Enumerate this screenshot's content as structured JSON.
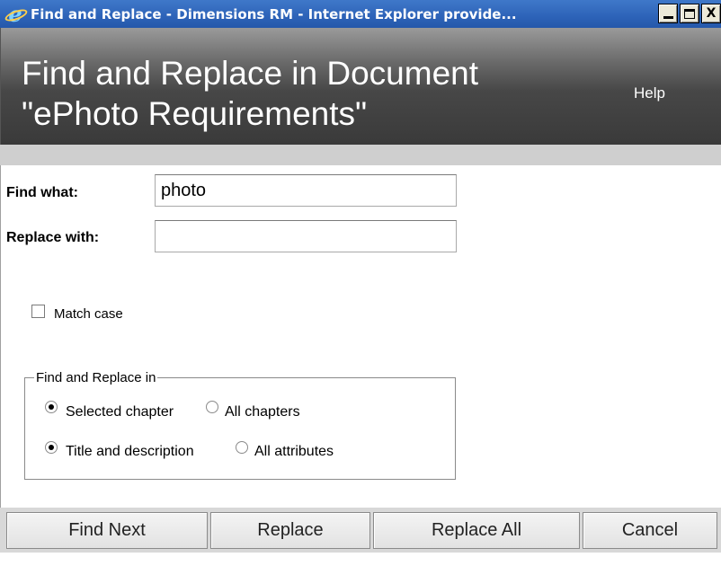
{
  "window": {
    "title": "Find and Replace - Dimensions RM - Internet Explorer provide...",
    "minimize_label": "",
    "maximize_label": "",
    "close_label": "X"
  },
  "header": {
    "title": "Find and Replace in Document \"ePhoto Requirements\"",
    "help_label": "Help"
  },
  "form": {
    "find_label": "Find what:",
    "find_value": "photo",
    "replace_label": "Replace with:",
    "replace_value": "",
    "match_case_label": "Match case",
    "match_case_checked": false
  },
  "scope_group": {
    "legend": "Find and Replace in",
    "chapter_options": [
      {
        "label": "Selected chapter",
        "checked": true
      },
      {
        "label": "All chapters",
        "checked": false
      }
    ],
    "field_options": [
      {
        "label": "Title and description",
        "checked": true
      },
      {
        "label": "All attributes",
        "checked": false
      }
    ]
  },
  "buttons": {
    "find_next": "Find Next",
    "replace": "Replace",
    "replace_all": "Replace All",
    "cancel": "Cancel"
  },
  "colors": {
    "titlebar": "#2d63b8",
    "header_dark": "#3a3a3a",
    "button_bar": "#d8d8d8"
  }
}
